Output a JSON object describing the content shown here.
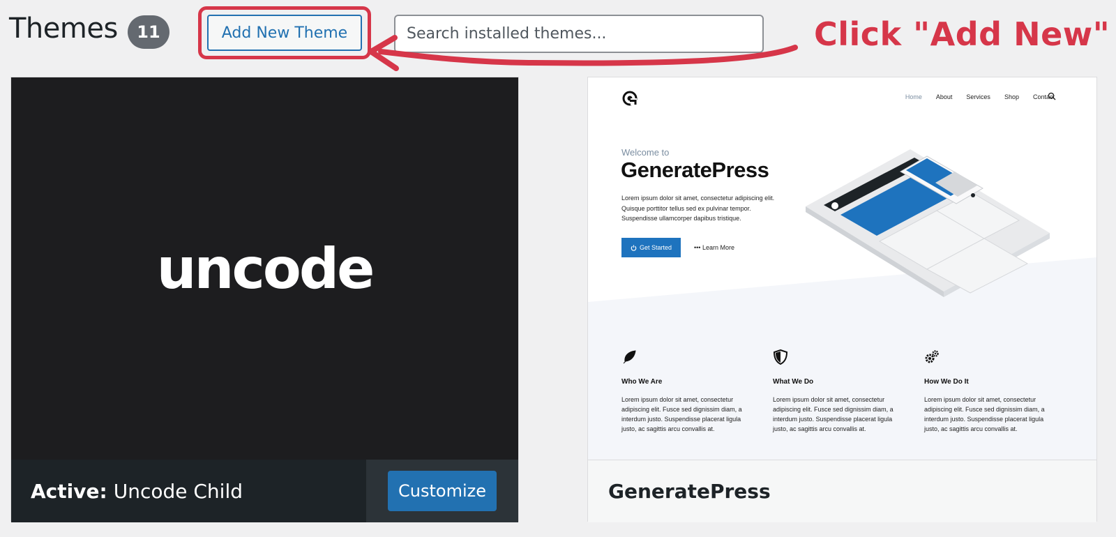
{
  "header": {
    "title": "Themes",
    "count": "11",
    "add_new_label": "Add New Theme",
    "search_placeholder": "Search installed themes..."
  },
  "annotation": {
    "callout": "Click \"Add New\"",
    "color": "#d63649"
  },
  "themes": [
    {
      "logo_text": "uncode",
      "active_prefix": "Active:",
      "name": "Uncode Child",
      "action_label": "Customize"
    },
    {
      "name": "GeneratePress",
      "preview": {
        "nav": [
          "Home",
          "About",
          "Services",
          "Shop",
          "Contact"
        ],
        "welcome": "Welcome to",
        "brand": "GeneratePress",
        "intro": "Lorem ipsum dolor sit amet, consectetur adipiscing elit. Quisque porttitor tellus sed ex pulvinar tempor. Suspendisse ullamcorper dapibus tristique.",
        "primary_button": "Get Started",
        "secondary_link": "Learn More",
        "features": [
          {
            "title": "Who We Are",
            "text": "Lorem ipsum dolor sit amet, consectetur adipiscing elit. Fusce sed dignissim diam, a interdum justo. Suspendisse placerat ligula justo, ac sagittis arcu convallis at.",
            "icon": "feather-icon"
          },
          {
            "title": "What We Do",
            "text": "Lorem ipsum dolor sit amet, consectetur adipiscing elit. Fusce sed dignissim diam, a interdum justo. Suspendisse placerat ligula justo, ac sagittis arcu convallis at.",
            "icon": "shield-icon"
          },
          {
            "title": "How We Do It",
            "text": "Lorem ipsum dolor sit amet, consectetur adipiscing elit. Fusce sed dignissim diam, a interdum justo. Suspendisse placerat ligula justo, ac sagittis arcu convallis at.",
            "icon": "gears-icon"
          }
        ]
      }
    }
  ],
  "colors": {
    "accent_blue": "#2271b1",
    "badge_gray": "#646970",
    "dark_panel": "#1d2327"
  }
}
